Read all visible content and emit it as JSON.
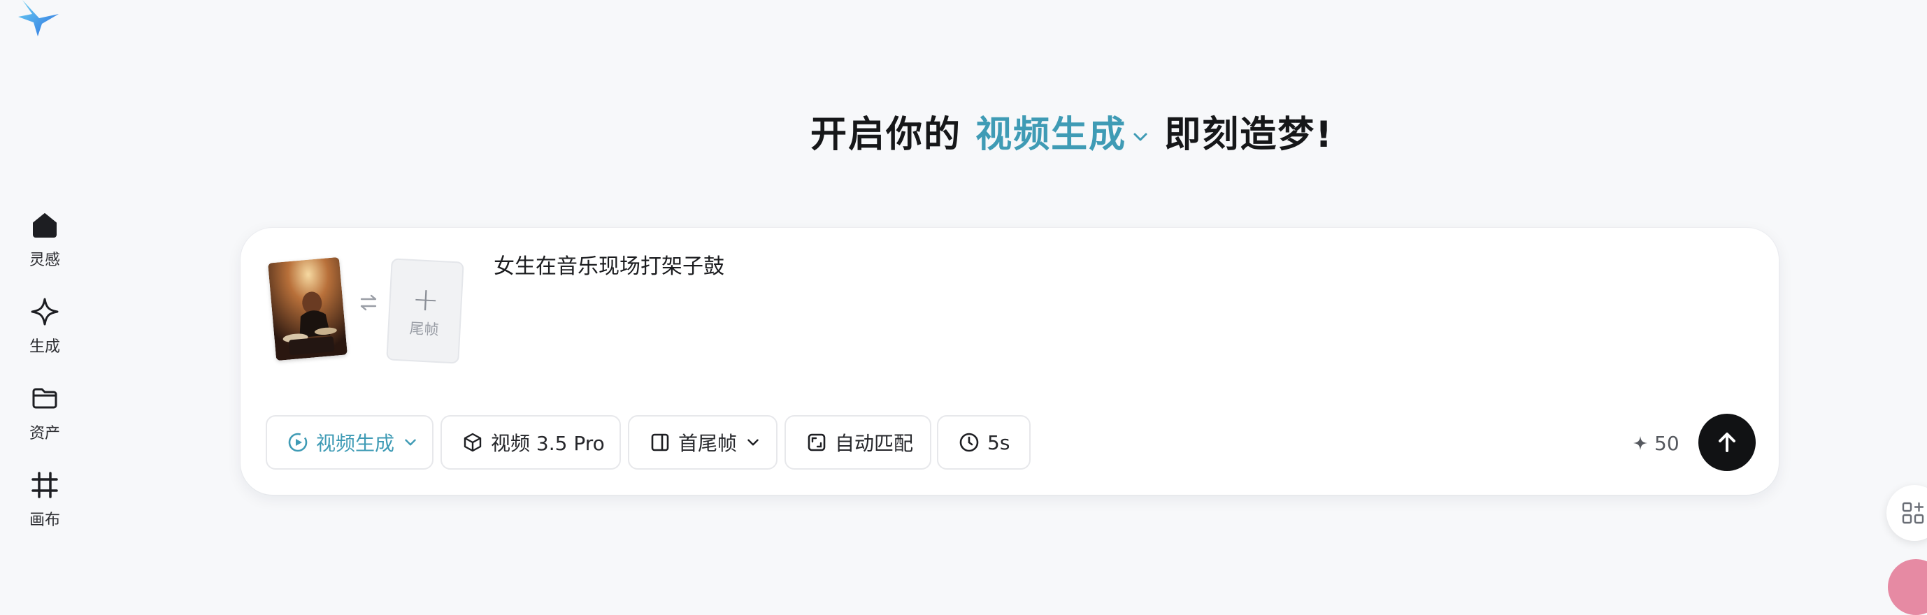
{
  "headline": {
    "prefix": "开启你的",
    "mode": "视频生成",
    "suffix": "即刻造梦!"
  },
  "sidebar": {
    "items": [
      {
        "label": "灵感",
        "icon": "home-icon"
      },
      {
        "label": "生成",
        "icon": "sparkle-icon"
      },
      {
        "label": "资产",
        "icon": "folder-icon"
      },
      {
        "label": "画布",
        "icon": "canvas-icon"
      }
    ]
  },
  "composer": {
    "end_frame_label": "尾帧",
    "prompt_text": "女生在音乐现场打架子鼓",
    "chips": {
      "mode": "视频生成",
      "model": "视频 3.5 Pro",
      "frames": "首尾帧",
      "ratio": "自动匹配",
      "duration": "5s"
    },
    "credits": "50"
  },
  "colors": {
    "accent": "#3f9bb5",
    "send_button": "#111214",
    "background": "#f7f8fa"
  }
}
